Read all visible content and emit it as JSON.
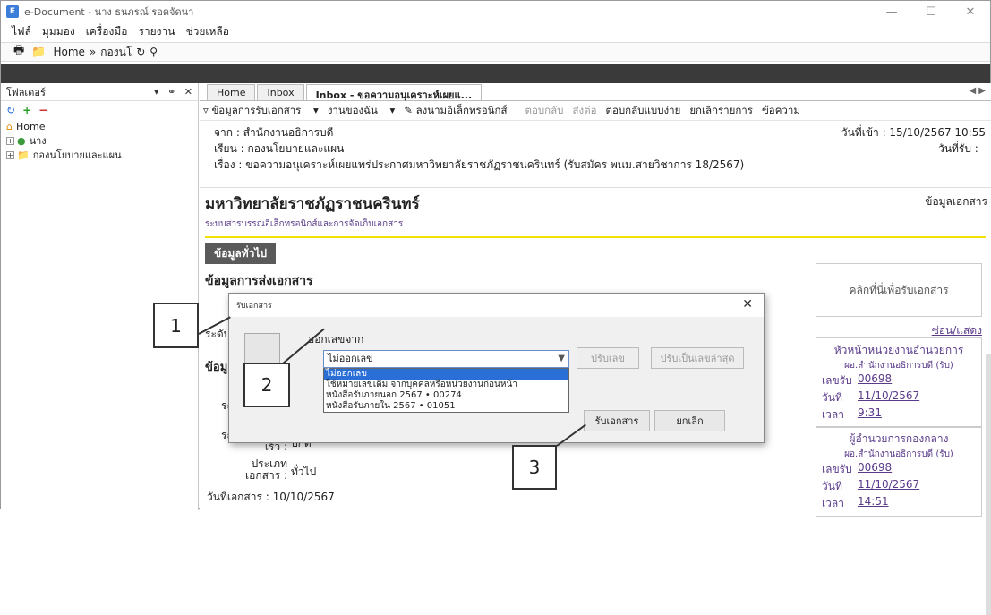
{
  "window": {
    "title": "e-Document - นาง ธนภรณ์ รอดจัดนา",
    "app_icon_text": "E"
  },
  "menu": [
    "ไฟล์",
    "มุมมอง",
    "เครื่องมือ",
    "รายงาน",
    "ช่วยเหลือ"
  ],
  "toolbar": {
    "home": "Home",
    "sep": "»",
    "folder": "กองนโ"
  },
  "folder_pane": {
    "title": "โฟลเดอร์",
    "items": [
      {
        "label": "Home"
      },
      {
        "label": "นาง"
      },
      {
        "label": "กองนโยบายและแผน"
      }
    ]
  },
  "tabs": [
    {
      "label": "Home"
    },
    {
      "label": "Inbox"
    },
    {
      "label": "Inbox - ขอความอนุเคราะห์เผยแ..."
    }
  ],
  "actions": [
    "ข้อมูลการรับเอกสาร",
    "งานของฉัน",
    "ลงนามอิเล็กทรอนิกส์",
    "ตอบกลับ",
    "ส่งต่อ",
    "ตอบกลับแบบง่าย",
    "ยกเลิกรายการ",
    "ข้อความ"
  ],
  "message": {
    "from": "จาก : สำนักงานอธิการบดี",
    "to": "เรียน : กองนโยบายและแผน",
    "subject": "เรื่อง : ขอความอนุเคราะห์เผยแพร่ประกาศมหาวิทยาลัยราชภัฏราชนครินทร์ (รับสมัคร พนม.สายวิชาการ 18/2567)",
    "date_in": "วันที่เข้า : 15/10/2567 10:55",
    "date_recv": "วันที่รับ : -"
  },
  "doc": {
    "title": "มหาวิทยาลัยราชภัฏราชนครินทร์",
    "subtitle": "ระบบสารบรรณอิเล็กทรอนิกส์และการจัดเก็บเอกสาร",
    "right_label": "ข้อมูลเอกสาร",
    "tab": "ข้อมูลทั่วไป",
    "section1": "ข้อมูลการส่งเอกสาร",
    "from_line": "จาก : สำนักงานอธิการบดี",
    "left_cut1": "ระดับ",
    "left_cut2": "ข้อมู",
    "left_cut3": "ระ",
    "speed_label": "ระดับชั้นความ",
    "speed_label2": "เร็ว :",
    "speed_value": "ปกติ",
    "type_label": "ประเภท",
    "type_label2": "เอกสาร :",
    "type_value": "ทั่วไป",
    "date_line": "วันที่เอกสาร : 10/10/2567"
  },
  "side": {
    "receive_btn": "คลิกที่นี่เพื่อรับเอกสาร",
    "toggle": "ซ่อน/แสดง",
    "cards": [
      {
        "head": "หัวหน้าหน่วยงานอำนวยการ",
        "sub": "ผอ.สำนักงานอธิการบดี (รับ)",
        "rows": [
          {
            "k": "เลขรับ",
            "v": "00698"
          },
          {
            "k": "วันที่",
            "v": "11/10/2567"
          },
          {
            "k": "เวลา",
            "v": "9:31"
          }
        ]
      },
      {
        "head": "ผู้อำนวยการกองกลาง",
        "sub": "ผอ.สำนักงานอธิการบดี (รับ)",
        "rows": [
          {
            "k": "เลขรับ",
            "v": "00698"
          },
          {
            "k": "วันที่",
            "v": "11/10/2567"
          },
          {
            "k": "เวลา",
            "v": "14:51"
          }
        ]
      }
    ]
  },
  "dialog": {
    "title": "รับเอกสาร",
    "label": "ออกเลขจาก",
    "selected": "ไม่ออกเลข",
    "options": [
      "ไม่ออกเลข",
      "ใช้หมายเลขเดิม จากบุคคลหรือหน่วยงานก่อนหน้า",
      "หนังสือรับภายนอก 2567 • 00274",
      "หนังสือรับภายใน 2567 • 01051"
    ],
    "btn_number": "ปรับเลข",
    "btn_latest": "ปรับเป็นเลขล่าสุด",
    "btn_receive": "รับเอกสาร",
    "btn_cancel": "ยกเลิก"
  },
  "callouts": [
    "1",
    "2",
    "3"
  ]
}
